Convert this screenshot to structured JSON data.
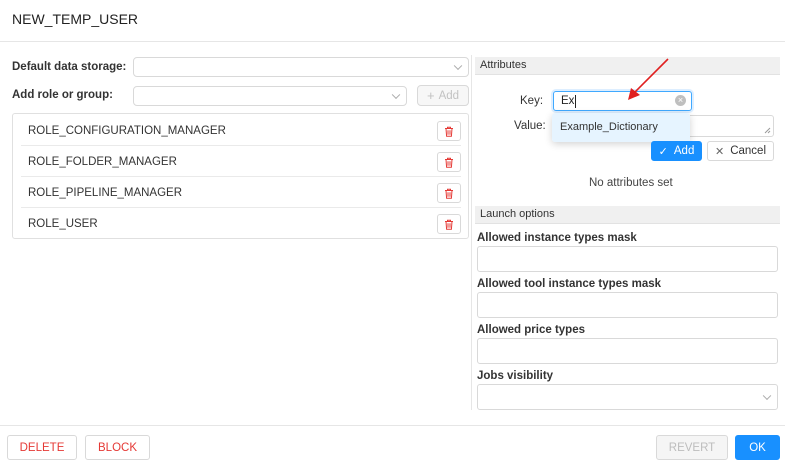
{
  "title": "NEW_TEMP_USER",
  "left": {
    "default_storage_label": "Default data storage:",
    "default_storage_value": "",
    "add_role_label": "Add role or group:",
    "add_role_value": "",
    "add_button_label": "Add",
    "roles": [
      {
        "name": "ROLE_CONFIGURATION_MANAGER"
      },
      {
        "name": "ROLE_FOLDER_MANAGER"
      },
      {
        "name": "ROLE_PIPELINE_MANAGER"
      },
      {
        "name": "ROLE_USER"
      }
    ]
  },
  "attributes": {
    "header": "Attributes",
    "key_label": "Key:",
    "key_value": "Ex",
    "value_label": "Value:",
    "value_value": "",
    "suggestion": "Example_Dictionary",
    "add_label": "Add",
    "cancel_label": "Cancel",
    "empty_text": "No attributes set"
  },
  "launch_options": {
    "header": "Launch options",
    "instance_types_label": "Allowed instance types mask",
    "tool_instance_types_label": "Allowed tool instance types mask",
    "price_types_label": "Allowed price types",
    "jobs_visibility_label": "Jobs visibility"
  },
  "footer": {
    "delete_label": "DELETE",
    "block_label": "BLOCK",
    "revert_label": "REVERT",
    "ok_label": "OK"
  },
  "colors": {
    "primary": "#1890ff",
    "danger": "#e53935",
    "annotation_arrow": "#e02020"
  }
}
